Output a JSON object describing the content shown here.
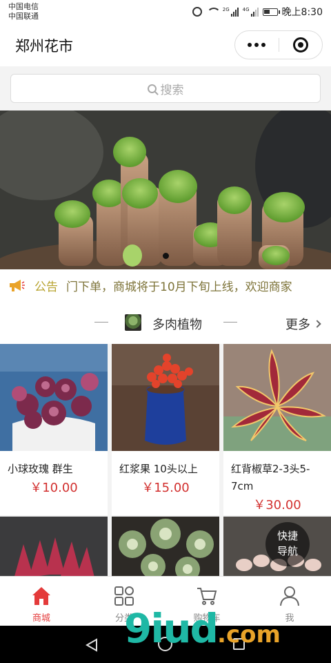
{
  "status_bar": {
    "carrier_1": "中国电信",
    "carrier_2": "中国联通",
    "net_1": "2G",
    "net_2": "4G",
    "time": "晚上8:30"
  },
  "nav_bar": {
    "title": "郑州花市"
  },
  "search": {
    "placeholder": "搜索"
  },
  "banner": {
    "active_index": 0
  },
  "notice": {
    "label": "公告",
    "text": "门下单，商城将于10月下旬上线，欢迎商家"
  },
  "section": {
    "title": "多肉植物",
    "more": "更多"
  },
  "products": [
    {
      "name": "小球玫瑰 群生",
      "price": "￥10.00"
    },
    {
      "name": "红浆果 10头以上",
      "price": "￥15.00"
    },
    {
      "name": "红背椒草2-3头5-7cm",
      "price": "￥30.00"
    },
    {
      "name": "",
      "price": ""
    },
    {
      "name": "",
      "price": ""
    },
    {
      "name": "",
      "price": ""
    }
  ],
  "quick_nav": {
    "line1": "快捷",
    "line2": "导航"
  },
  "tab_bar": {
    "tabs": [
      {
        "label": "商城",
        "icon": "home-icon",
        "active": true
      },
      {
        "label": "分类",
        "icon": "category-icon",
        "active": false
      },
      {
        "label": "购物车",
        "icon": "cart-icon",
        "active": false
      },
      {
        "label": "我",
        "icon": "user-icon",
        "active": false
      }
    ]
  },
  "watermark": {
    "main": "9iud",
    "suffix": ".com"
  },
  "colors": {
    "accent": "#e43b3b",
    "price": "#d2302f",
    "notice": "#b8a431"
  }
}
